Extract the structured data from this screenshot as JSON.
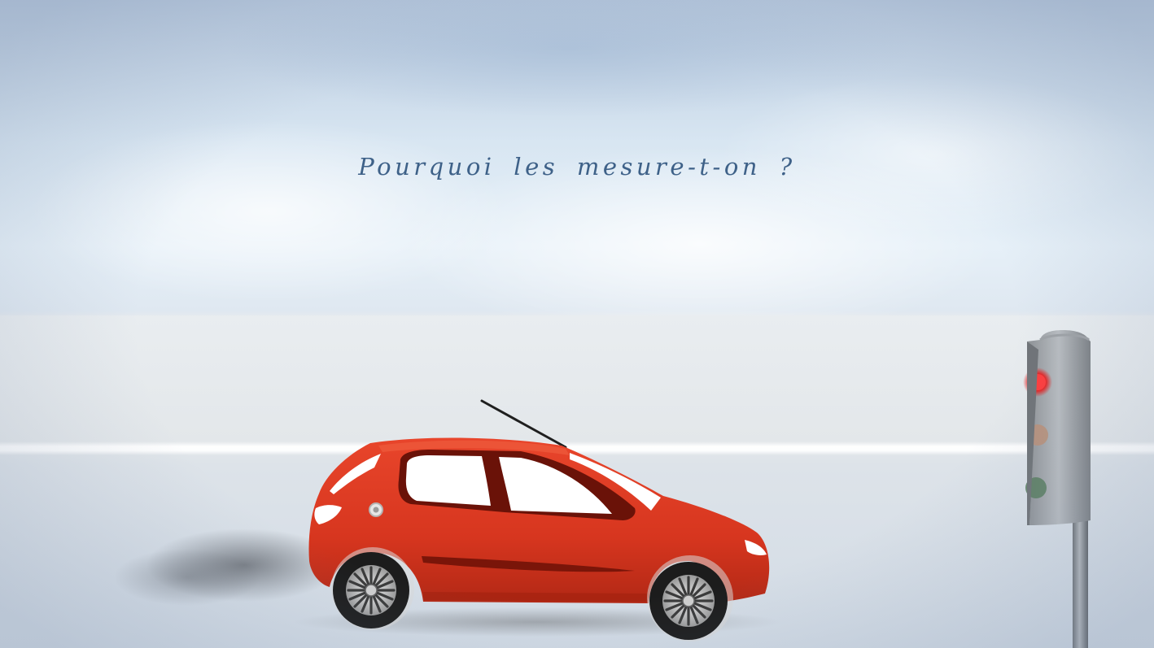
{
  "title": "Pourquoi les mesure-t-on ?",
  "colors": {
    "title_text": "#3e6188",
    "car_body": "#dd3a22",
    "sky": "#d8e6f2",
    "road": "#e4e8ec"
  },
  "scene": {
    "vehicle": "red-hatchback-car",
    "signal": "traffic-light",
    "signal_active_light": "red"
  }
}
